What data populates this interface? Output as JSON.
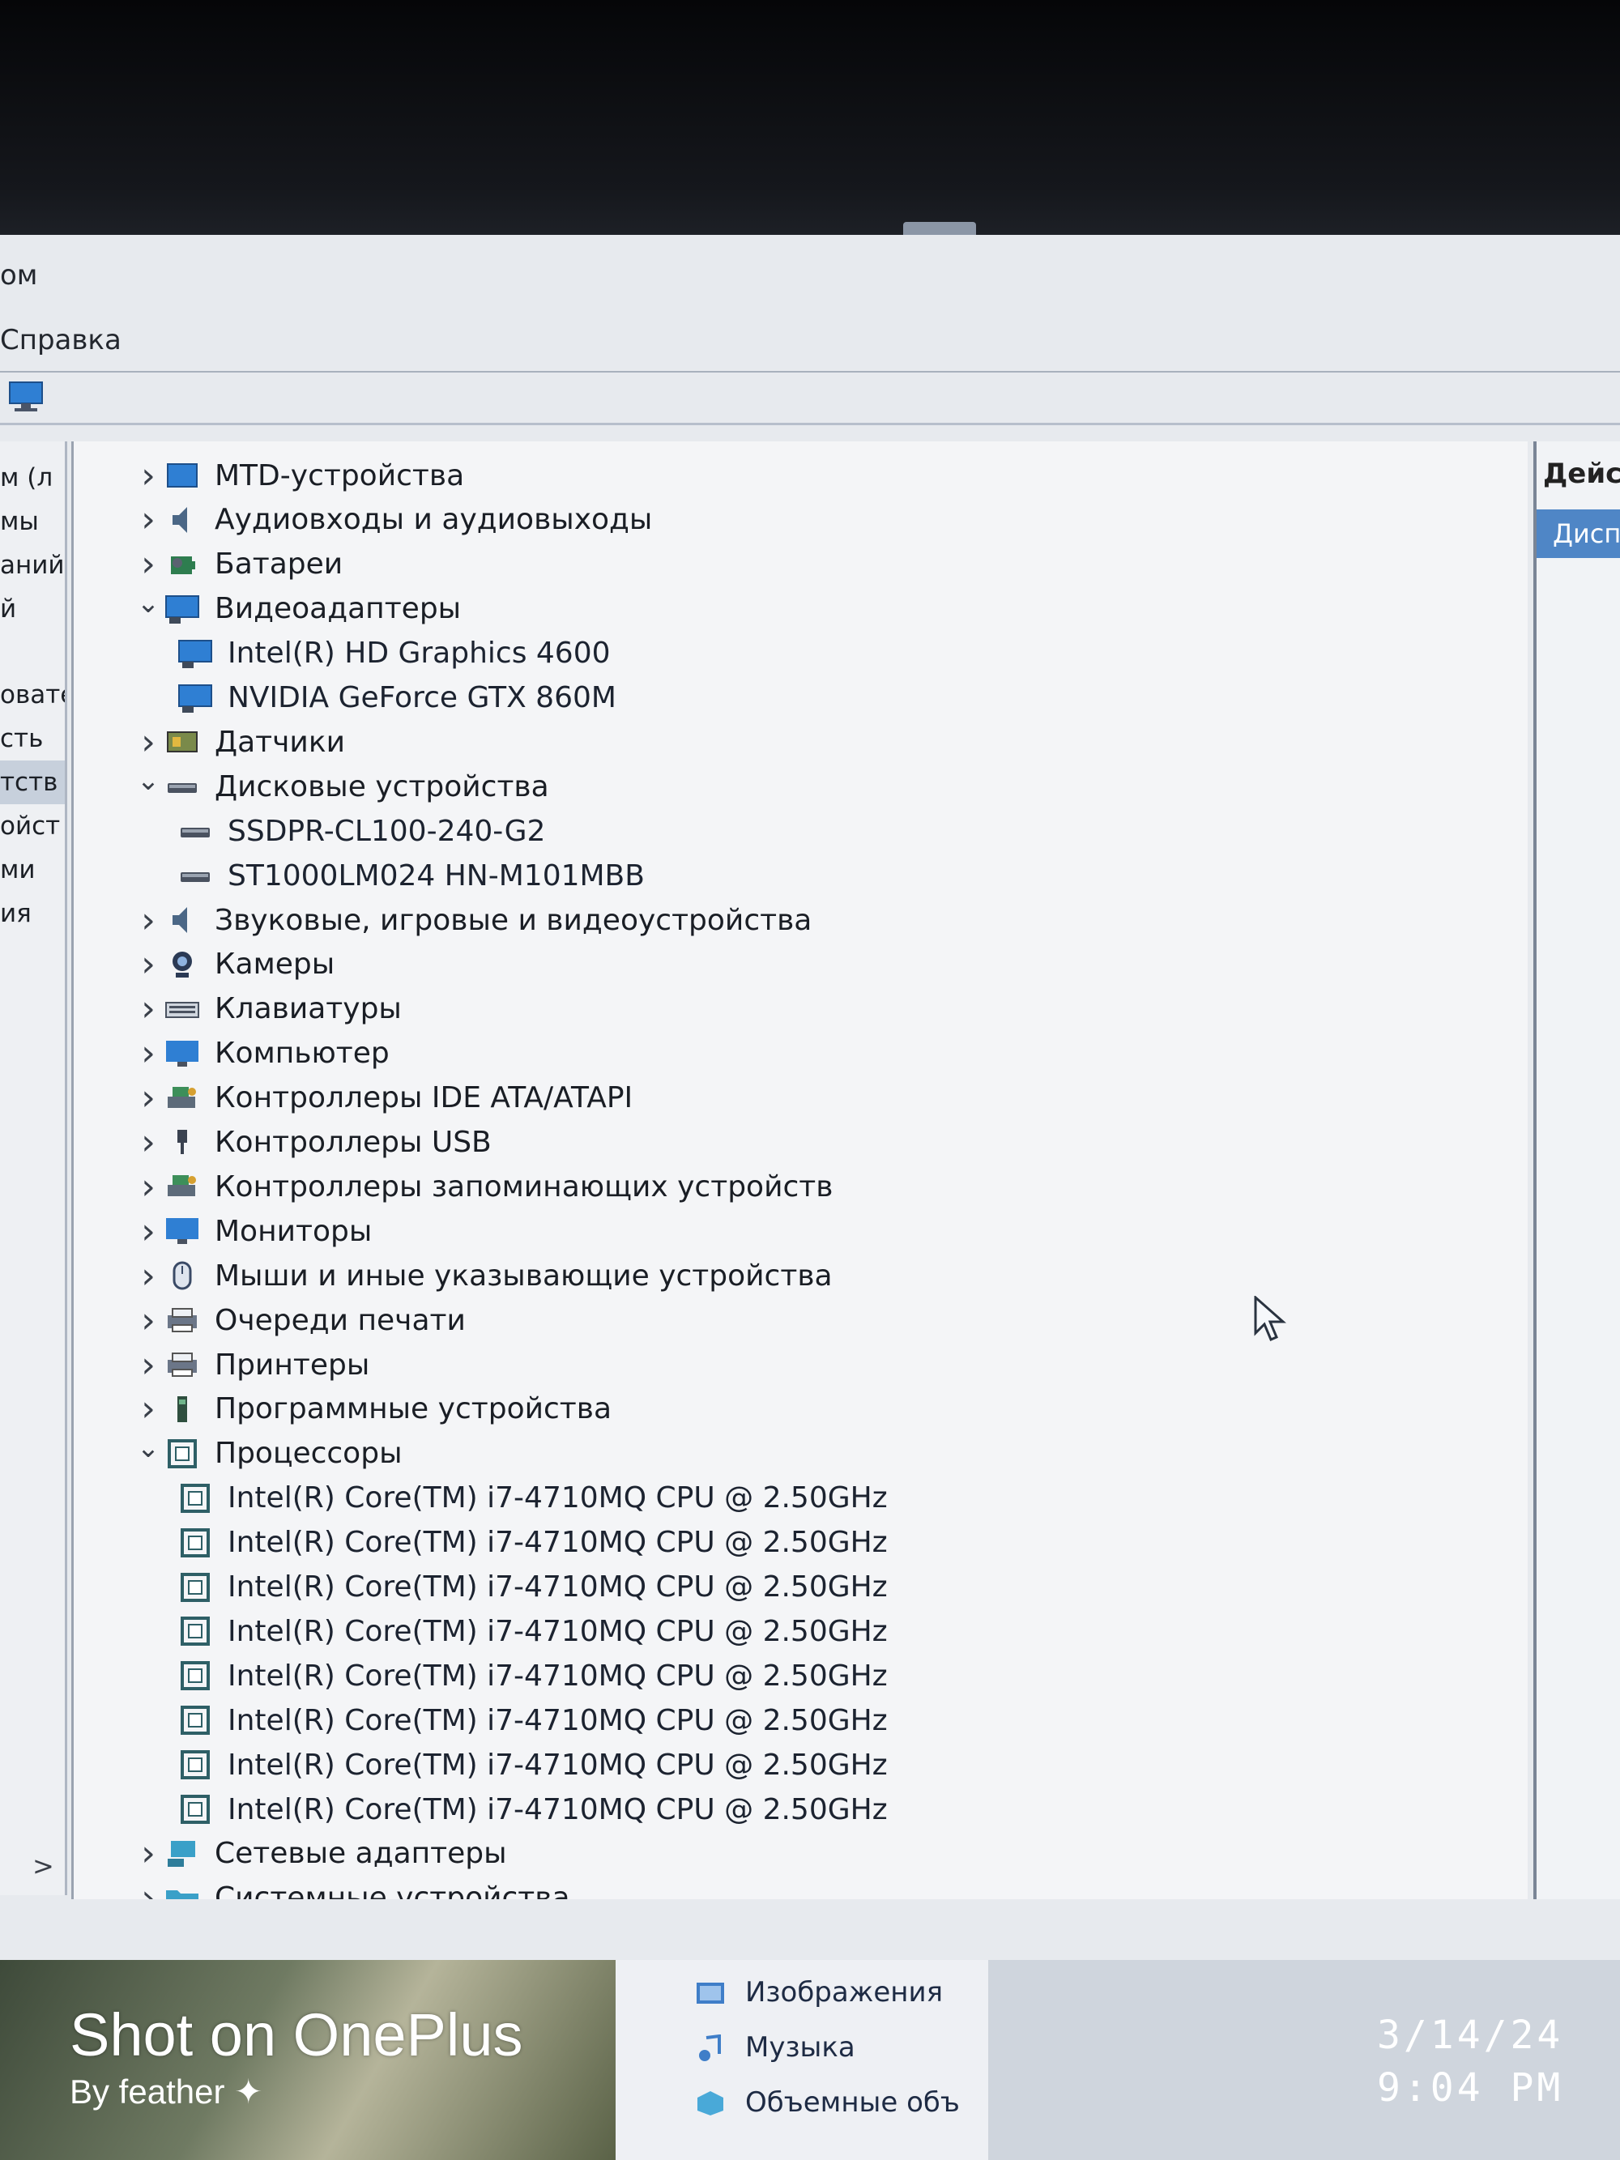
{
  "menu": {
    "row1_fragment": "ом",
    "row2_fragment": "Справка"
  },
  "left_pane": {
    "items": [
      "м (л",
      "мы",
      "аний",
      "й",
      "овате",
      "сть",
      "тств",
      "ойст",
      "ми",
      "ия"
    ],
    "selected_index": 6,
    "scroll_right_glyph": ">"
  },
  "tree": {
    "rows": [
      {
        "label": "MTD-устройства",
        "icon": "mtd-device-icon",
        "chevron": "right",
        "level": 0
      },
      {
        "label": "Аудиовходы и аудиовыходы",
        "icon": "speaker-icon",
        "chevron": "right",
        "level": 0
      },
      {
        "label": "Батареи",
        "icon": "battery-icon",
        "chevron": "right",
        "level": 0
      },
      {
        "label": "Видеоадаптеры",
        "icon": "display-adapter-icon",
        "chevron": "down",
        "level": 0
      },
      {
        "label": "Intel(R) HD Graphics 4600",
        "icon": "display-adapter-icon",
        "chevron": "none",
        "level": 1
      },
      {
        "label": "NVIDIA GeForce GTX 860M",
        "icon": "display-adapter-icon",
        "chevron": "none",
        "level": 1
      },
      {
        "label": "Датчики",
        "icon": "sensor-icon",
        "chevron": "right",
        "level": 0
      },
      {
        "label": "Дисковые устройства",
        "icon": "disk-drive-icon",
        "chevron": "down",
        "level": 0
      },
      {
        "label": "SSDPR-CL100-240-G2",
        "icon": "disk-drive-icon",
        "chevron": "none",
        "level": 1
      },
      {
        "label": "ST1000LM024 HN-M101MBB",
        "icon": "disk-drive-icon",
        "chevron": "none",
        "level": 1
      },
      {
        "label": "Звуковые, игровые и видеоустройства",
        "icon": "speaker-icon",
        "chevron": "right",
        "level": 0
      },
      {
        "label": "Камеры",
        "icon": "camera-icon",
        "chevron": "right",
        "level": 0
      },
      {
        "label": "Клавиатуры",
        "icon": "keyboard-icon",
        "chevron": "right",
        "level": 0
      },
      {
        "label": "Компьютер",
        "icon": "computer-icon",
        "chevron": "right",
        "level": 0
      },
      {
        "label": "Контроллеры IDE ATA/ATAPI",
        "icon": "ide-controller-icon",
        "chevron": "right",
        "level": 0
      },
      {
        "label": "Контроллеры USB",
        "icon": "usb-icon",
        "chevron": "right",
        "level": 0
      },
      {
        "label": "Контроллеры запоминающих устройств",
        "icon": "storage-controller-icon",
        "chevron": "right",
        "level": 0
      },
      {
        "label": "Мониторы",
        "icon": "monitor-icon",
        "chevron": "right",
        "level": 0
      },
      {
        "label": "Мыши и иные указывающие устройства",
        "icon": "mouse-icon",
        "chevron": "right",
        "level": 0
      },
      {
        "label": "Очереди печати",
        "icon": "printer-icon",
        "chevron": "right",
        "level": 0
      },
      {
        "label": "Принтеры",
        "icon": "printer-icon",
        "chevron": "right",
        "level": 0
      },
      {
        "label": "Программные устройства",
        "icon": "software-device-icon",
        "chevron": "right",
        "level": 0
      },
      {
        "label": "Процессоры",
        "icon": "processor-icon",
        "chevron": "down",
        "level": 0
      },
      {
        "label": "Intel(R) Core(TM) i7-4710MQ CPU @ 2.50GHz",
        "icon": "processor-icon",
        "chevron": "none",
        "level": 1
      },
      {
        "label": "Intel(R) Core(TM) i7-4710MQ CPU @ 2.50GHz",
        "icon": "processor-icon",
        "chevron": "none",
        "level": 1
      },
      {
        "label": "Intel(R) Core(TM) i7-4710MQ CPU @ 2.50GHz",
        "icon": "processor-icon",
        "chevron": "none",
        "level": 1
      },
      {
        "label": "Intel(R) Core(TM) i7-4710MQ CPU @ 2.50GHz",
        "icon": "processor-icon",
        "chevron": "none",
        "level": 1
      },
      {
        "label": "Intel(R) Core(TM) i7-4710MQ CPU @ 2.50GHz",
        "icon": "processor-icon",
        "chevron": "none",
        "level": 1
      },
      {
        "label": "Intel(R) Core(TM) i7-4710MQ CPU @ 2.50GHz",
        "icon": "processor-icon",
        "chevron": "none",
        "level": 1
      },
      {
        "label": "Intel(R) Core(TM) i7-4710MQ CPU @ 2.50GHz",
        "icon": "processor-icon",
        "chevron": "none",
        "level": 1
      },
      {
        "label": "Intel(R) Core(TM) i7-4710MQ CPU @ 2.50GHz",
        "icon": "processor-icon",
        "chevron": "none",
        "level": 1
      },
      {
        "label": "Сетевые адаптеры",
        "icon": "network-adapter-icon",
        "chevron": "right",
        "level": 0
      },
      {
        "label": "Системные устройства",
        "icon": "folder-icon",
        "chevron": "right",
        "level": 0
      }
    ]
  },
  "actions_pane": {
    "header": "Дейс",
    "selected_item": "Дисп"
  },
  "explorer_strip": {
    "items": [
      "Изображения",
      "Музыка",
      "Объемные объ"
    ]
  },
  "photo_overlay": {
    "brand": "Shot on OnePlus",
    "byline": "By feather",
    "date": "3/14/24",
    "time": "9:04 PM"
  },
  "colors": {
    "window_bg": "#e7eaee",
    "tree_bg": "#f4f5f7",
    "selection_blue": "#4f86c6",
    "icon_blue": "#2f7fd3",
    "processor_teal": "#2e5f66"
  }
}
